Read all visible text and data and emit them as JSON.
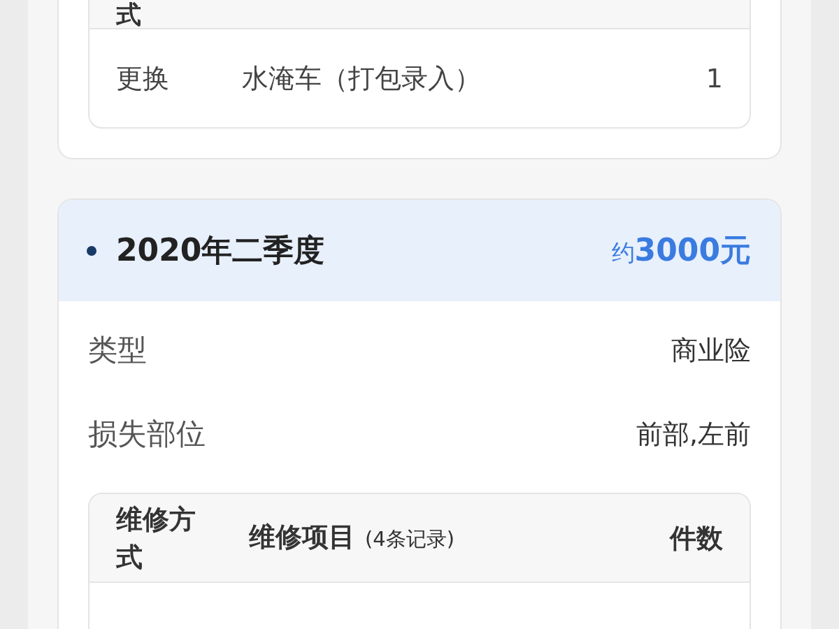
{
  "previous_record": {
    "table": {
      "header_tail": "式",
      "rows": [
        {
          "method": "更换",
          "item": "水淹车（打包录入）",
          "count": "1"
        }
      ]
    }
  },
  "record": {
    "title": "2020年二季度",
    "amount_prefix": "约",
    "amount": "3000元",
    "fields": [
      {
        "label": "类型",
        "value": "商业险"
      },
      {
        "label": "损失部位",
        "value": "前部,左前"
      }
    ],
    "table": {
      "columns": [
        "维修方式",
        "维修项目",
        "件数"
      ],
      "record_count": "(4条记录)"
    }
  }
}
